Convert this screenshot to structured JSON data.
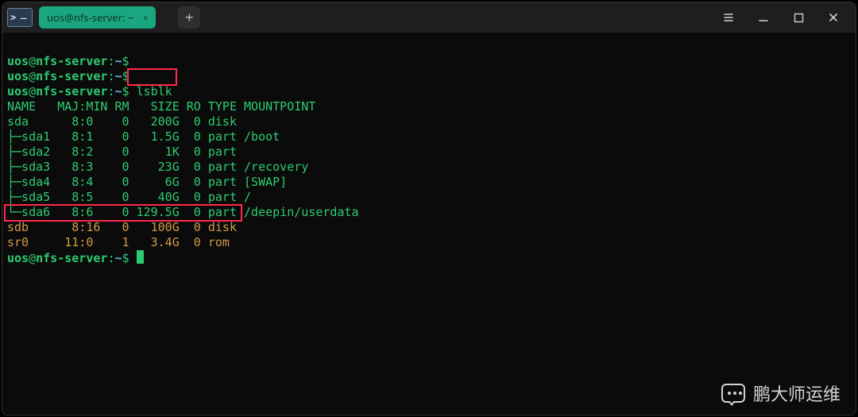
{
  "window": {
    "tab_title": "uos@nfs-server: ~",
    "new_tab_label": "+"
  },
  "prompt": {
    "user": "uos",
    "at": "@",
    "host": "nfs-server",
    "colon": ":",
    "path": "~",
    "sigil": "$"
  },
  "command": "lsblk",
  "lsblk": {
    "header": "NAME   MAJ:MIN RM   SIZE RO TYPE MOUNTPOINT",
    "rows": [
      "sda      8:0    0   200G  0 disk ",
      "├─sda1   8:1    0   1.5G  0 part /boot",
      "├─sda2   8:2    0     1K  0 part ",
      "├─sda3   8:3    0    23G  0 part /recovery",
      "├─sda4   8:4    0     6G  0 part [SWAP]",
      "├─sda5   8:5    0    40G  0 part /",
      "└─sda6   8:6    0 129.5G  0 part /deepin/userdata",
      "sdb      8:16   0   100G  0 disk ",
      "sr0     11:0    1   3.4G  0 rom  "
    ]
  },
  "chart_data": {
    "type": "table",
    "title": "lsblk",
    "columns": [
      "NAME",
      "MAJ:MIN",
      "RM",
      "SIZE",
      "RO",
      "TYPE",
      "MOUNTPOINT"
    ],
    "rows": [
      [
        "sda",
        "8:0",
        0,
        "200G",
        0,
        "disk",
        ""
      ],
      [
        "sda1",
        "8:1",
        0,
        "1.5G",
        0,
        "part",
        "/boot"
      ],
      [
        "sda2",
        "8:2",
        0,
        "1K",
        0,
        "part",
        ""
      ],
      [
        "sda3",
        "8:3",
        0,
        "23G",
        0,
        "part",
        "/recovery"
      ],
      [
        "sda4",
        "8:4",
        0,
        "6G",
        0,
        "part",
        "[SWAP]"
      ],
      [
        "sda5",
        "8:5",
        0,
        "40G",
        0,
        "part",
        "/"
      ],
      [
        "sda6",
        "8:6",
        0,
        "129.5G",
        0,
        "part",
        "/deepin/userdata"
      ],
      [
        "sdb",
        "8:16",
        0,
        "100G",
        0,
        "disk",
        ""
      ],
      [
        "sr0",
        "11:0",
        1,
        "3.4G",
        0,
        "rom",
        ""
      ]
    ]
  },
  "highlights": {
    "box1_targets_command": "lsblk",
    "box2_targets_row": "sdb      8:16   0   100G  0 disk "
  },
  "watermark": {
    "text": "鹏大师运维"
  }
}
